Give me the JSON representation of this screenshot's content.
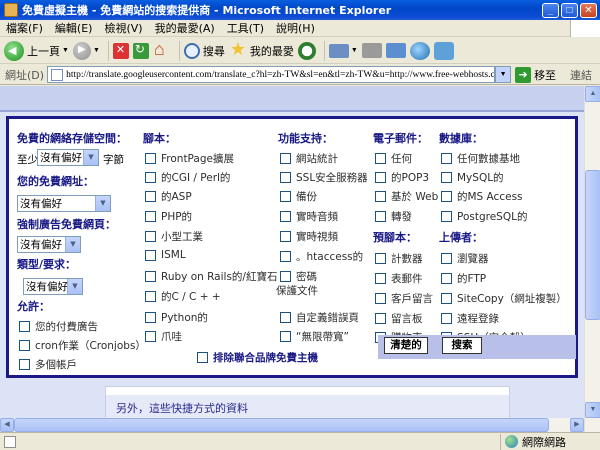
{
  "window": {
    "title": "免費虛擬主機 - 免費網站的搜索提供商 - Microsoft Internet Explorer"
  },
  "menu": [
    "檔案(F)",
    "編輯(E)",
    "檢視(V)",
    "我的最愛(A)",
    "工具(T)",
    "說明(H)"
  ],
  "toolbar": {
    "back_label": "上一頁",
    "search_label": "搜尋",
    "favorites_label": "我的最愛"
  },
  "address": {
    "label": "網址(D)",
    "url": "http://translate.googleusercontent.com/translate_c?hl=zh-TW&sl=en&tl=zh-TW&u=http://www.free-webhosts.com/power-search",
    "go_label": "移至",
    "links_label": "連結"
  },
  "form": {
    "storage_label": "免費的網絡存儲空間：",
    "at_least": "至少",
    "storage_select": "沒有偏好",
    "bytes": "字節",
    "domain_label": "您的免費網址：",
    "domain_select": "沒有偏好",
    "forced_ads_label": "強制廣告免費網頁：",
    "forced_ads_select": "沒有偏好",
    "type_label": "類型/要求：",
    "type_select": "沒有偏好",
    "allow_label": "允許：",
    "allow_items": [
      "您的付費廣告",
      "cron作業（Cronjobs）",
      "多個帳戶"
    ],
    "scripts_label": "腳本：",
    "scripts_items": [
      "FrontPage擴展",
      "的CGI / Perl的",
      "的ASP",
      "PHP的",
      "小型工業",
      "ISML",
      "Ruby on Rails的/紅寶石",
      "的C / C + +",
      "Python的",
      "爪哇"
    ],
    "features_label": "功能支持：",
    "features_items": [
      "網站統計",
      "SSL安全服務器",
      "備份",
      "實時音頻",
      "實時視頻",
      "。htaccess的",
      "密碼",
      "自定義錯誤頁",
      "“無限帶寬”"
    ],
    "password_line2": "保護文件",
    "email_label": "電子郵件：",
    "email_items": [
      "任何",
      "的POP3",
      "基於 Web",
      "轉發"
    ],
    "preset_label": "預腳本：",
    "preset_items": [
      "計數器",
      "表郵件",
      "客戶留言",
      "留言板",
      "購物車"
    ],
    "db_label": "數據庫：",
    "db_items": [
      "任何數據基地",
      "MySQL的",
      "的MS Access",
      "PostgreSQL的"
    ],
    "upload_label": "上傳者：",
    "upload_items": [
      "瀏覽器",
      "的FTP",
      "SiteCopy（網址複製）",
      "遠程登錄",
      "SSH（安全殼）"
    ],
    "exclude_label": "排除聯合品牌免費主機",
    "clear_button": "清楚的",
    "search_button": "搜索"
  },
  "below": {
    "text": "另外，這些快捷方式的資料"
  },
  "status": {
    "zone": "網際網路"
  }
}
